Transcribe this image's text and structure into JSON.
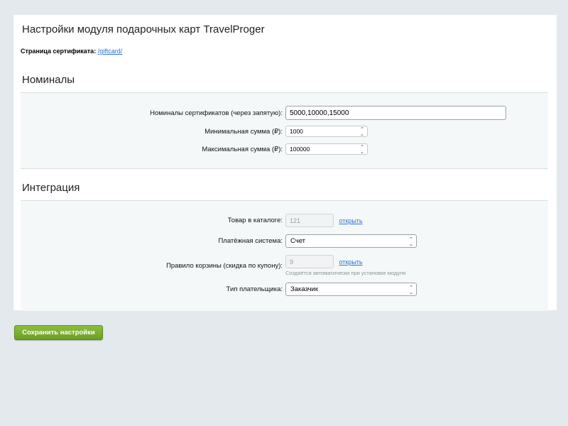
{
  "page_title": "Настройки модуля подарочных карт TravelProger",
  "certificate_page": {
    "label": "Страница сертификата:",
    "link": "/giftcard/"
  },
  "nominals": {
    "title": "Номиналы",
    "fields": {
      "certificates_label": "Номиналы сертификатов (через запятую):",
      "certificates_value": "5000,10000,15000",
      "min_label": "Минимальная сумма (₽):",
      "min_value": "1000",
      "max_label": "Максимальная сумма (₽):",
      "max_value": "100000"
    }
  },
  "integration": {
    "title": "Интеграция",
    "fields": {
      "catalog_label": "Товар в каталоге:",
      "catalog_value": "121",
      "catalog_link": "открыть",
      "payment_label": "Платёжная система:",
      "payment_value": "Счет",
      "basket_label": "Правило корзины (скидка по купону):",
      "basket_value": "9",
      "basket_link": "открыть",
      "basket_hint": "Создаётся автоматически при установке модуля",
      "payer_label": "Тип плательщика:",
      "payer_value": "Заказчик"
    }
  },
  "save_button": "Сохранить настройки",
  "colors": {
    "background": "#e3e9ec",
    "link": "#2675d7",
    "save_button": "#7aaf30"
  },
  "icons": {
    "select_arrows": "up-down-chevron-icon"
  }
}
